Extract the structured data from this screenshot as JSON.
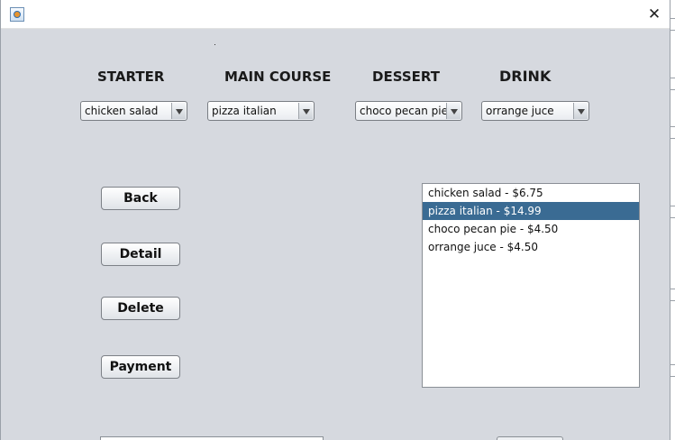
{
  "window": {
    "title": "",
    "close_glyph": "✕",
    "icon": "java-app-icon"
  },
  "headings": {
    "starter": "STARTER",
    "main_course": "MAIN COURSE",
    "dessert": "DESSERT",
    "drink": "DRINK"
  },
  "selects": {
    "starter": "chicken salad",
    "main_course": "pizza italian",
    "dessert": "choco pecan pie",
    "drink": "orrange juce"
  },
  "buttons": {
    "back": "Back",
    "detail": "Detail",
    "delete": "Delete",
    "payment": "Payment"
  },
  "order_list": {
    "items": [
      "chicken salad - $6.75",
      "pizza italian - $14.99",
      "choco pecan pie - $4.50",
      "orrange juce - $4.50"
    ],
    "selected_index": 1
  },
  "colors": {
    "background": "#d6d9df",
    "selection": "#3a6b93"
  }
}
